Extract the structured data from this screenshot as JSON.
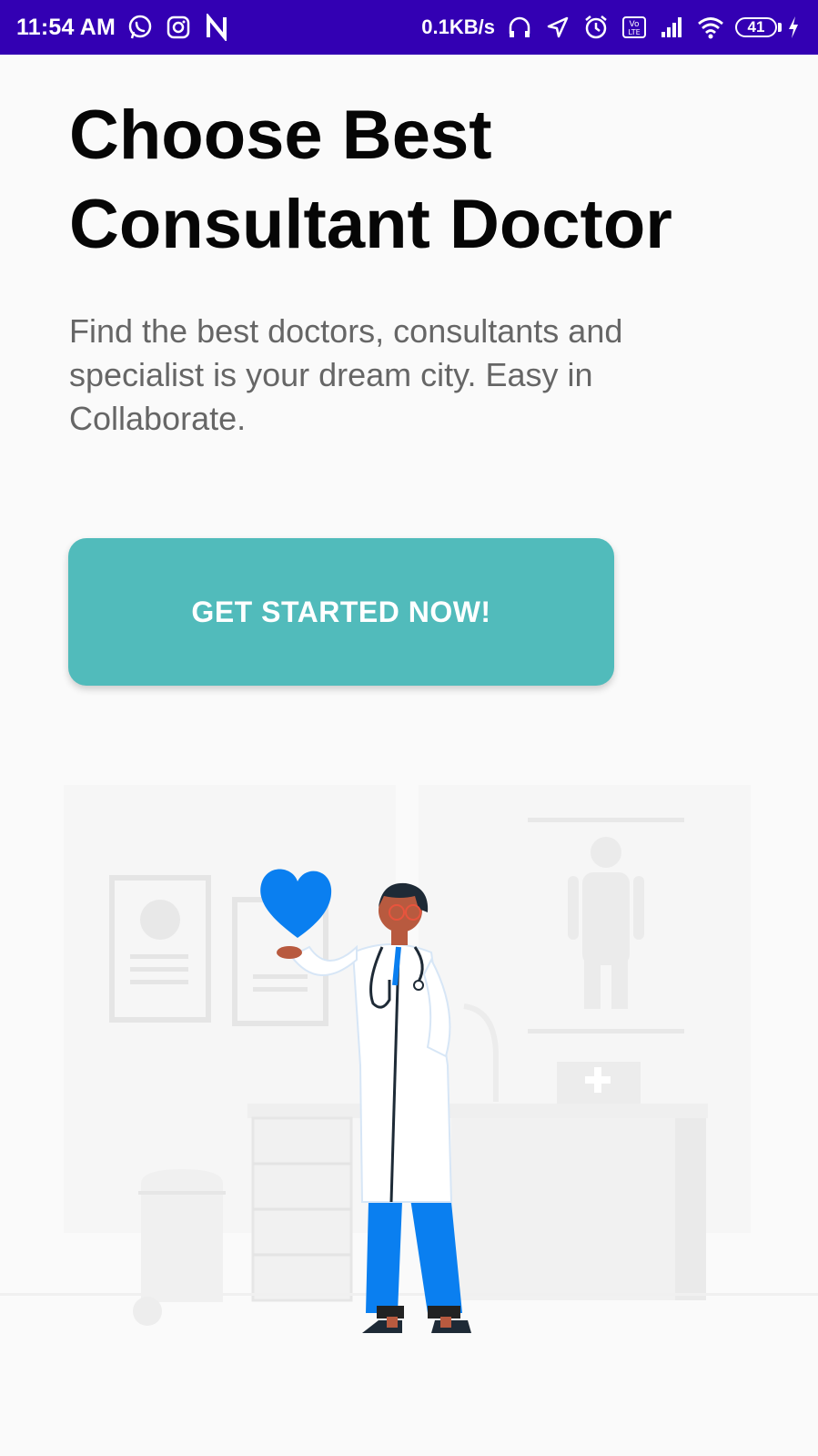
{
  "status_bar": {
    "time": "11:54 AM",
    "left_icons": [
      "whatsapp-icon",
      "instagram-icon",
      "n-app-icon"
    ],
    "net_speed": "0.1KB/s",
    "right_icons": [
      "headphones-icon",
      "location-arrow-icon",
      "alarm-icon",
      "volte-icon",
      "signal-icon",
      "wifi-icon"
    ],
    "battery_level": "41",
    "charging": true,
    "background_color": "#3300b3"
  },
  "hero": {
    "title_line1": "Choose Best",
    "title_line2": "Consultant Doctor",
    "subtitle": "Find the best doctors, consultants and specialist is your dream city. Easy in Collaborate."
  },
  "cta": {
    "label": "GET STARTED NOW!",
    "color": "#51bbbb"
  },
  "illustration": {
    "icon": "doctor-holding-heart-illustration",
    "accent_color": "#0a7ff0"
  }
}
